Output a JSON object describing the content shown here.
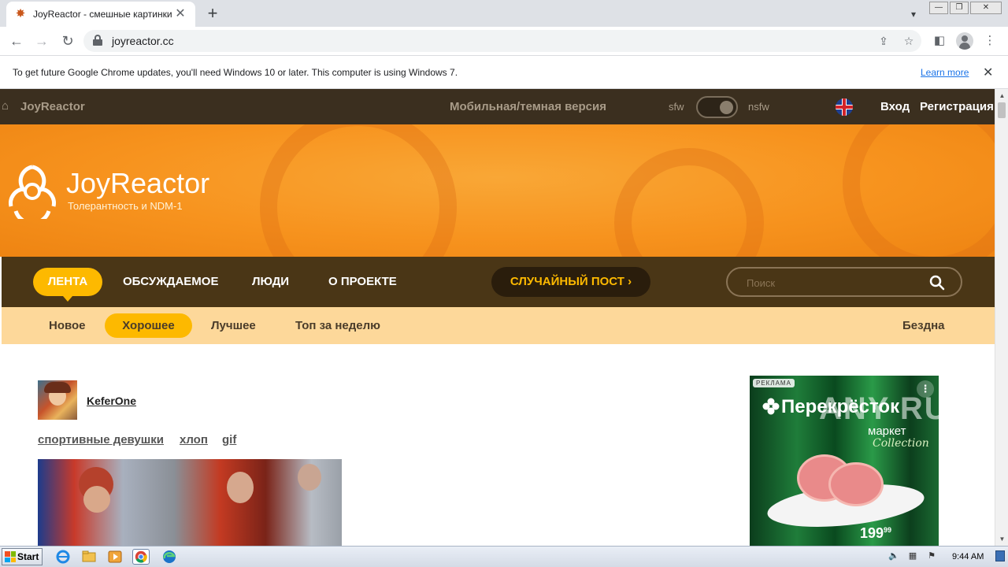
{
  "browser": {
    "tab_title": "JoyReactor - смешные картинки и",
    "tab_close_glyph": "✕",
    "new_tab_glyph": "+",
    "url": "joyreactor.cc",
    "window_controls": [
      "—",
      "❐",
      "✕"
    ]
  },
  "infobar": {
    "message": "To get future Google Chrome updates, you'll need Windows 10 or later. This computer is using Windows 7.",
    "learn_more": "Learn more",
    "close_glyph": "✕"
  },
  "site": {
    "topbar": {
      "brand": "JoyReactor",
      "mobile_version": "Мобильная/темная версия",
      "sfw": "sfw",
      "nsfw": "nsfw",
      "nsfw_enabled": true,
      "login": "Вход",
      "register": "Регистрация"
    },
    "banner": {
      "logo_text": "JoyReactor",
      "tagline": "Толерантность и NDM-1"
    },
    "main_nav": {
      "items": [
        "ЛЕНТА",
        "ОБСУЖДАЕМОЕ",
        "ЛЮДИ",
        "О ПРОЕКТЕ"
      ],
      "active": "ЛЕНТА",
      "random_post": "СЛУЧАЙНЫЙ ПОСТ",
      "random_arrow": "›",
      "search_placeholder": "Поиск"
    },
    "sub_nav": {
      "items": [
        "Новое",
        "Хорошее",
        "Лучшее",
        "Топ за неделю"
      ],
      "active": "Хорошее",
      "right_item": "Бездна"
    },
    "post": {
      "author": "KeferOne",
      "tags": [
        "спортивные девушки",
        "хлоп",
        "gif"
      ]
    },
    "ad": {
      "label": "РЕКЛАМА",
      "menu_glyph": "⋮",
      "brand": "Перекрёсток",
      "market": "маркет",
      "collection": "Collection",
      "price_main": "199",
      "price_cents": "99"
    }
  },
  "watermark": "ANY RUN",
  "taskbar": {
    "start_label": "Start",
    "clock": "9:44 AM"
  },
  "colors": {
    "site_topbar": "#3b2f1f",
    "banner_orange": "#f7931e",
    "main_nav_bg": "#4a3616",
    "accent_yellow": "#fdb900",
    "sub_nav_bg": "#fdd89a"
  }
}
